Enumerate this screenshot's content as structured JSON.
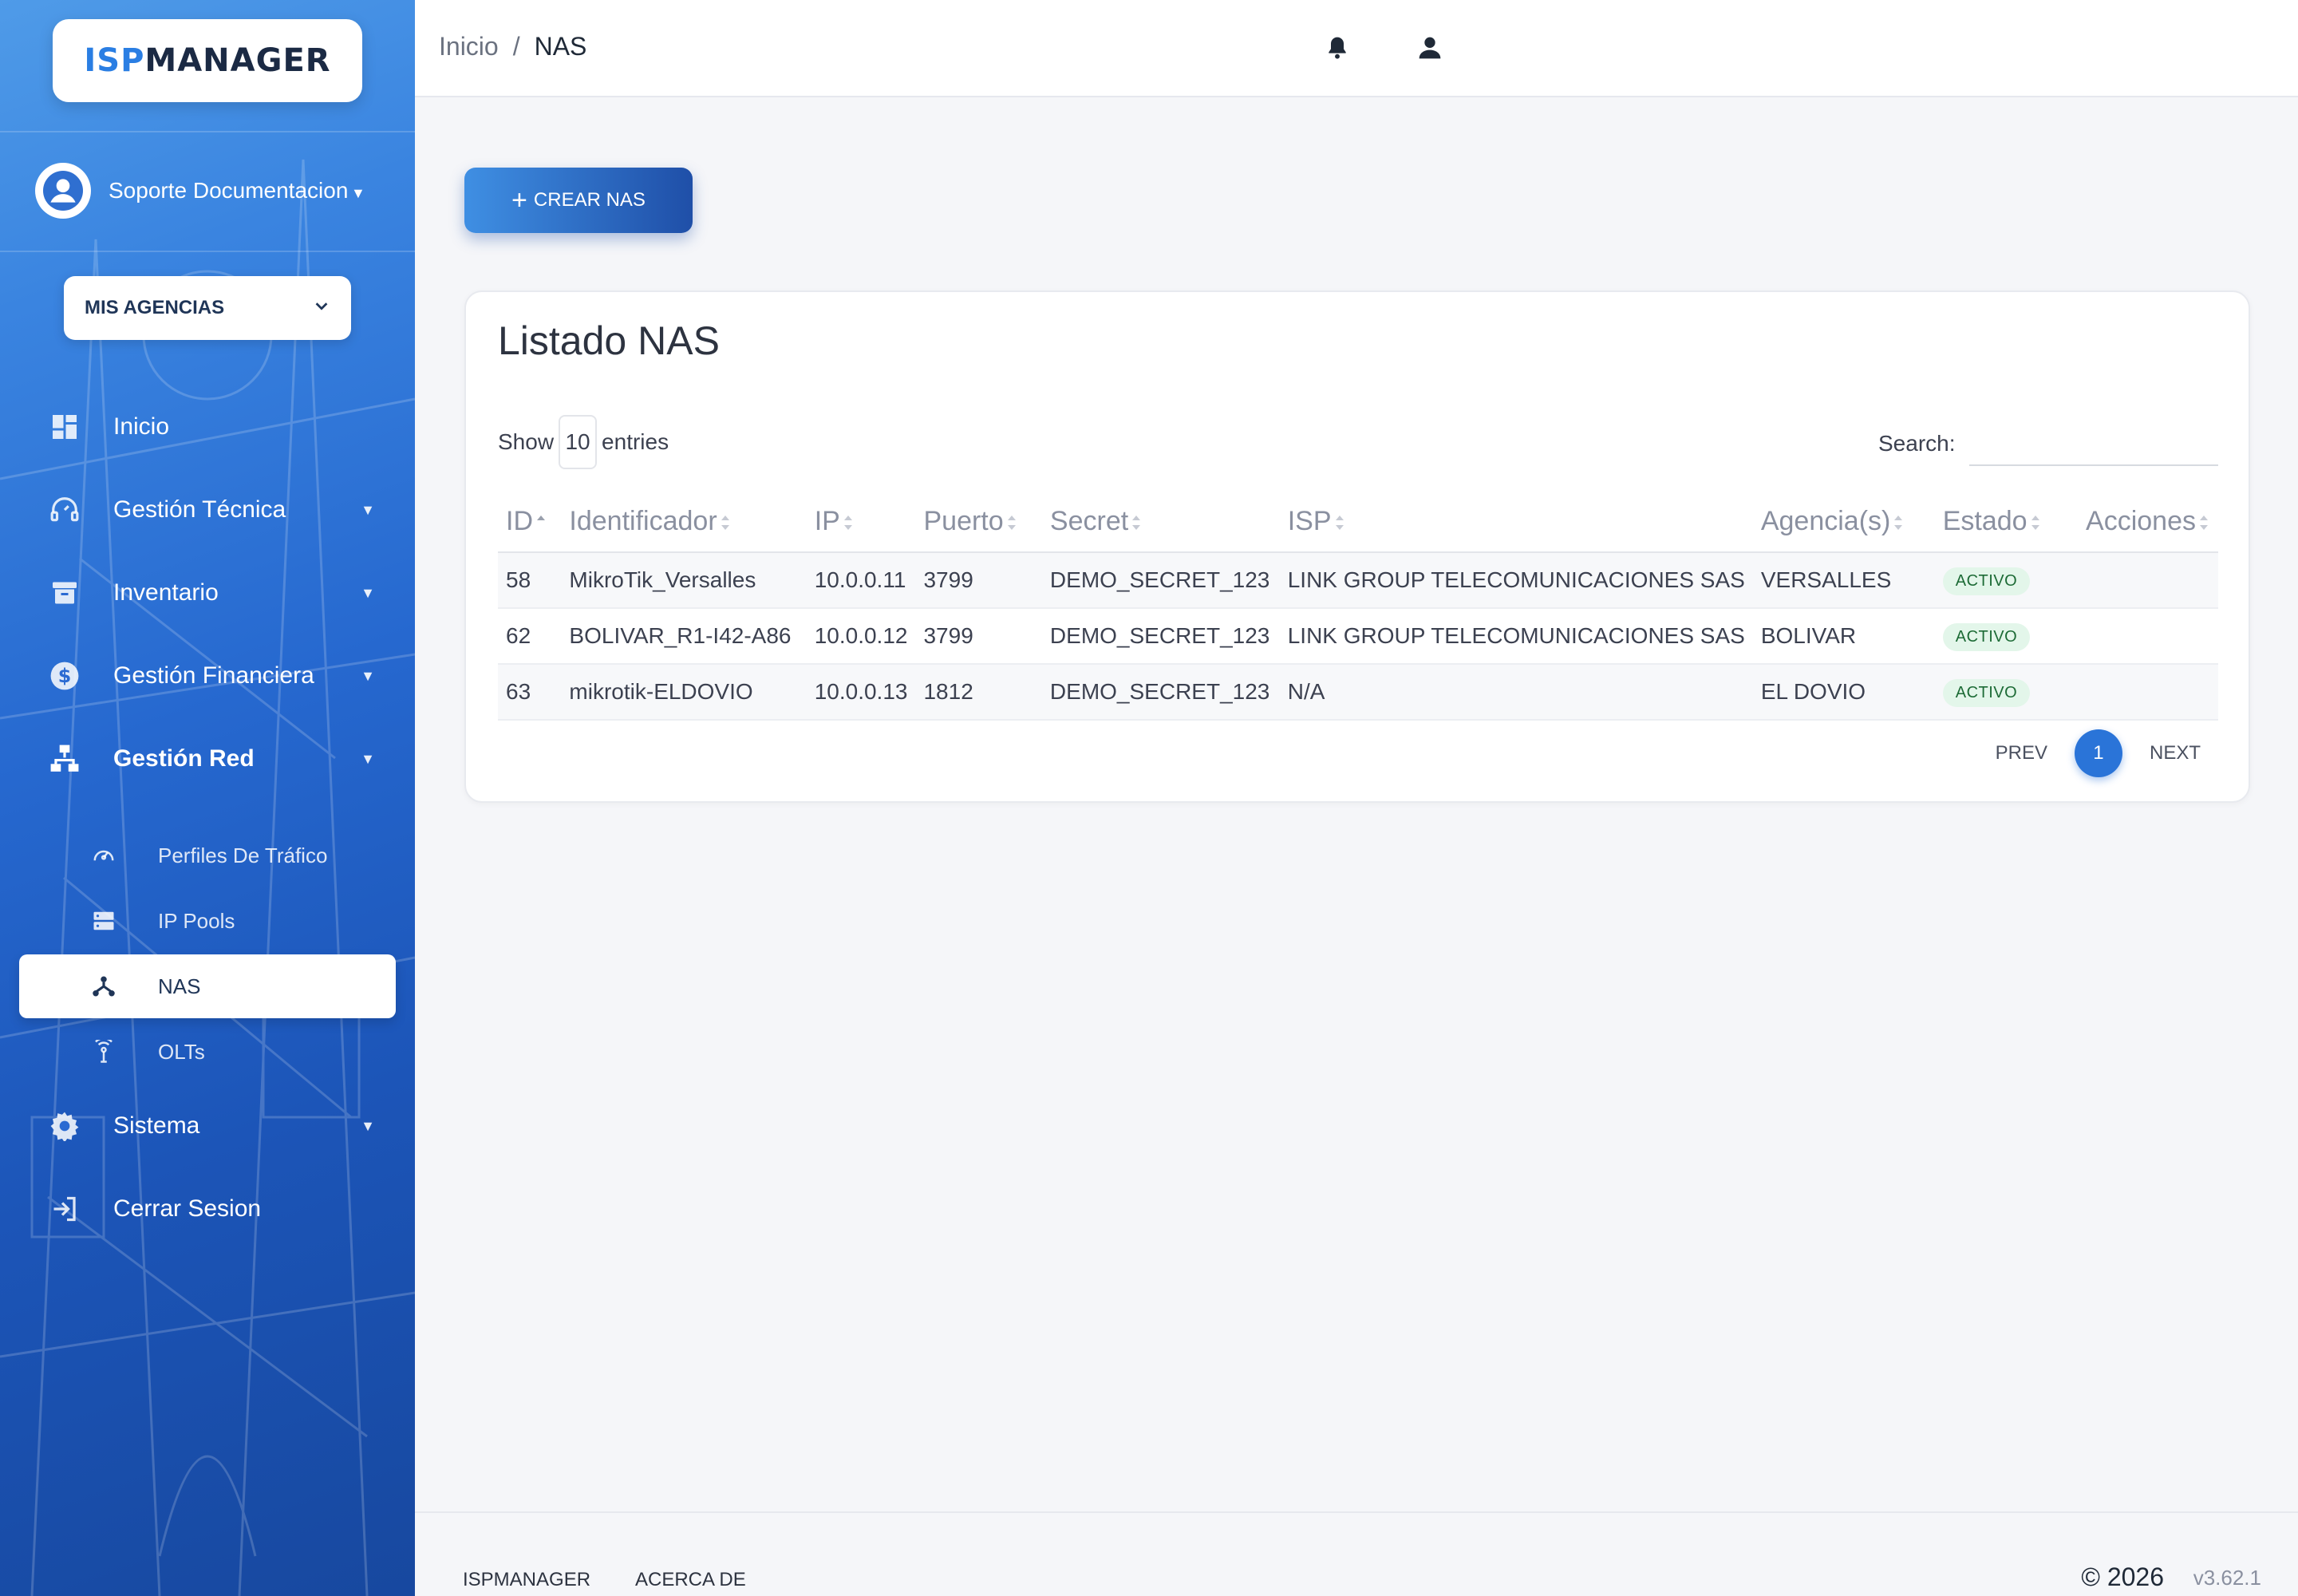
{
  "brand": {
    "isp": "ISP",
    "manager": "MANAGER"
  },
  "user": {
    "name": "Soporte Documentacion"
  },
  "agencias": {
    "label": "MIS AGENCIAS"
  },
  "nav": {
    "inicio": "Inicio",
    "gestion_tecnica": "Gestión Técnica",
    "inventario": "Inventario",
    "gestion_financiera": "Gestión Financiera",
    "gestion_red": "Gestión Red",
    "sistema": "Sistema",
    "cerrar_sesion": "Cerrar Sesion"
  },
  "subnav": {
    "perfiles": "Perfiles De Tráfico",
    "ip_pools": "IP Pools",
    "nas": "NAS",
    "olts": "OLTs"
  },
  "breadcrumb": {
    "home": "Inicio",
    "separator": "/",
    "current": "NAS"
  },
  "actions": {
    "create_label": "CREAR NAS"
  },
  "card": {
    "title": "Listado NAS",
    "show_label": "Show",
    "entries_value": "10",
    "entries_label": "entries",
    "search_label": "Search:",
    "search_value": ""
  },
  "table": {
    "headers": {
      "id": "ID",
      "identificador": "Identificador",
      "ip": "IP",
      "puerto": "Puerto",
      "secret": "Secret",
      "isp": "ISP",
      "agencias": "Agencia(s)",
      "estado": "Estado",
      "acciones": "Acciones"
    },
    "rows": [
      {
        "id": "58",
        "identificador": "MikroTik_Versalles",
        "ip": "10.0.0.11",
        "puerto": "3799",
        "secret": "DEMO_SECRET_123",
        "isp": "LINK GROUP TELECOMUNICACIONES SAS",
        "agencias": "VERSALLES",
        "estado": "ACTIVO"
      },
      {
        "id": "62",
        "identificador": "BOLIVAR_R1-I42-A86",
        "ip": "10.0.0.12",
        "puerto": "3799",
        "secret": "DEMO_SECRET_123",
        "isp": "LINK GROUP TELECOMUNICACIONES SAS",
        "agencias": "BOLIVAR",
        "estado": "ACTIVO"
      },
      {
        "id": "63",
        "identificador": "mikrotik-ELDOVIO",
        "ip": "10.0.0.13",
        "puerto": "1812",
        "secret": "DEMO_SECRET_123",
        "isp": "N/A",
        "agencias": "EL DOVIO",
        "estado": "ACTIVO"
      }
    ]
  },
  "pagination": {
    "prev": "PREV",
    "current": "1",
    "next": "NEXT"
  },
  "footer": {
    "brand": "ISPMANAGER",
    "about": "ACERCA DE",
    "copyright": "© 2026",
    "version": "v3.62.1"
  },
  "icons": {
    "notifications": "bell-icon",
    "account": "user-icon",
    "inicio": "dashboard-icon",
    "gestion_tecnica": "headset-icon",
    "inventario": "archive-icon",
    "gestion_financiera": "dollar-icon",
    "gestion_red": "network-icon",
    "sistema": "gear-icon",
    "cerrar_sesion": "logout-icon"
  },
  "colors": {
    "accent": "#2a74d8",
    "sidebar_dark": "#17489f",
    "badge_bg": "#e3f6ea",
    "badge_text": "#1d6b36"
  }
}
